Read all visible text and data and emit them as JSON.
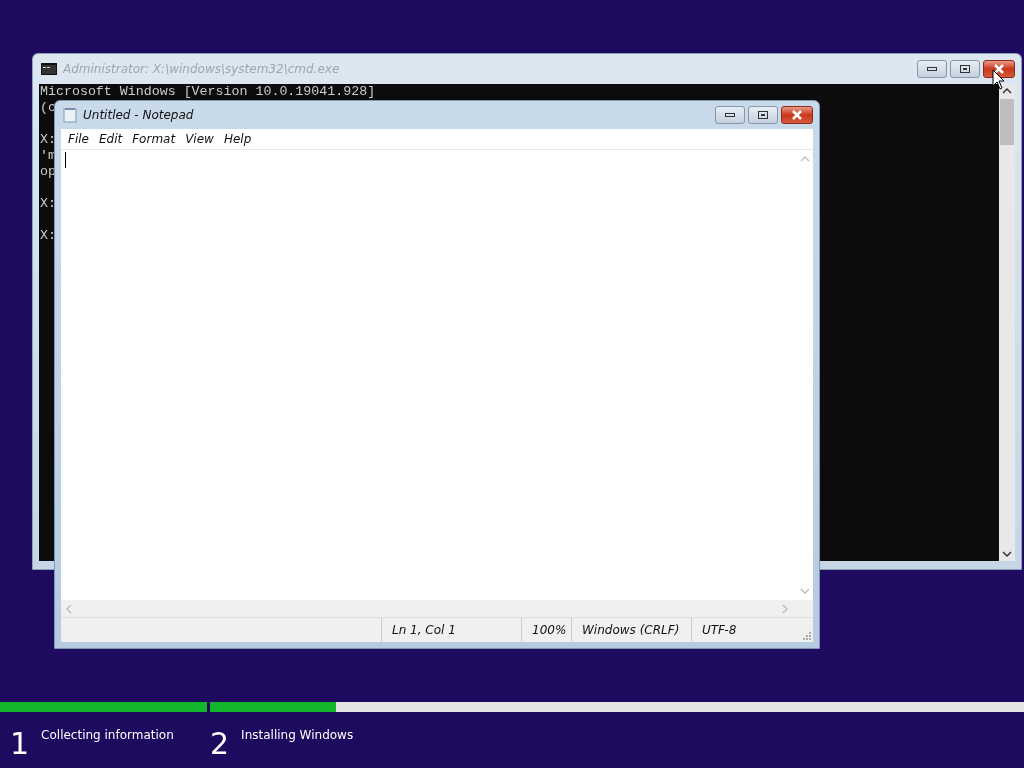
{
  "console_window": {
    "title": "Administrator: X:\\windows\\system32\\cmd.exe",
    "active": false,
    "lines": [
      {
        "text": "Microsoft Windows [Version 10.0.19041.928]",
        "gap_before": false
      },
      {
        "text": "(c",
        "gap_before": false
      },
      {
        "text": "X:",
        "gap_before": true
      },
      {
        "text": "'m",
        "gap_before": false
      },
      {
        "text": "op",
        "gap_before": false
      },
      {
        "text": "X:",
        "gap_before": true
      },
      {
        "text": "X:",
        "gap_before": true
      }
    ]
  },
  "notepad_window": {
    "title": "Untitled - Notepad",
    "active": true,
    "menu": [
      "File",
      "Edit",
      "Format",
      "View",
      "Help"
    ],
    "status_bar": [
      "Ln 1, Col 1",
      "100%",
      "Windows (CRLF)",
      "UTF-8"
    ]
  },
  "setup_progress": {
    "steps": [
      {
        "number": "1",
        "label": "Collecting information",
        "level": 1
      },
      {
        "number": "2",
        "label": "Installing Windows",
        "level": 0.155
      }
    ]
  }
}
